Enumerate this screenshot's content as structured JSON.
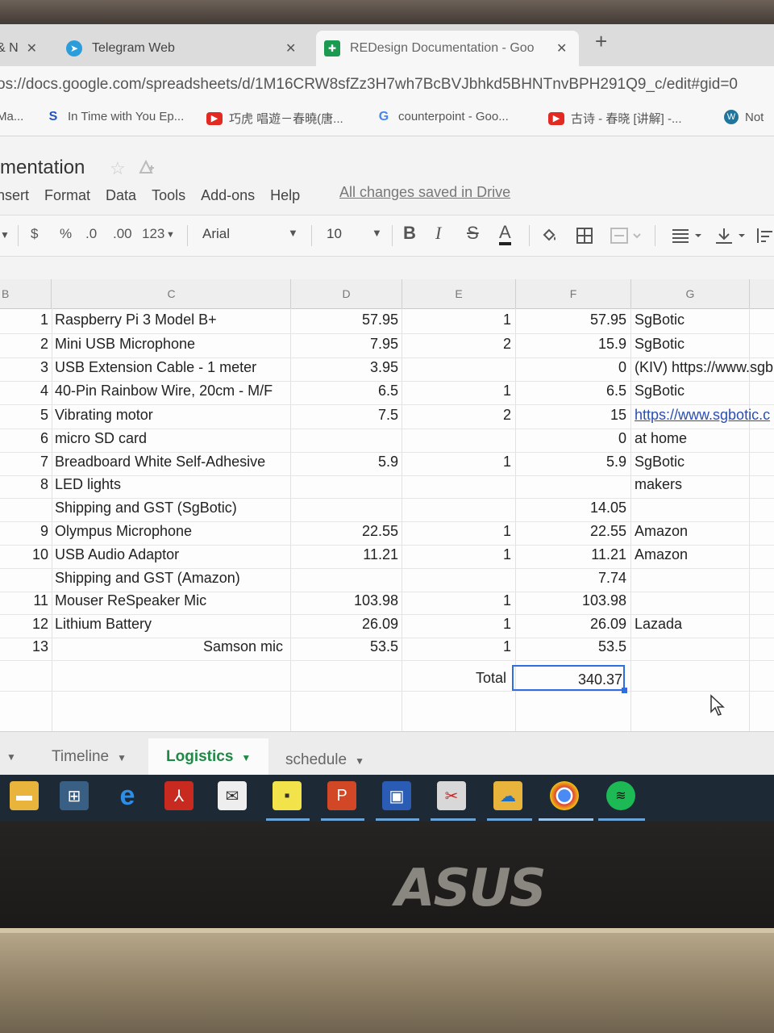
{
  "browser": {
    "tabs": [
      {
        "label": "& N",
        "close": "✕"
      },
      {
        "label": "Telegram Web",
        "close": "✕"
      },
      {
        "label": "REDesign Documentation - Goo",
        "close": "✕"
      }
    ],
    "new_tab": "+",
    "url": "os://docs.google.com/spreadsheets/d/1M16CRW8sfZz3H7wh7BcBVJbhkd5BHNTnvBPH291Q9_c/edit#gid=0",
    "bookmarks": [
      {
        "label": "Ma..."
      },
      {
        "label": "In Time with You Ep..."
      },
      {
        "label": "巧虎 唱遊－春曉(唐..."
      },
      {
        "label": "counterpoint - Goo..."
      },
      {
        "label": "古诗 - 春晓 [讲解] -..."
      },
      {
        "label": "Not"
      }
    ]
  },
  "doc": {
    "title": "mentation",
    "menu": [
      "nsert",
      "Format",
      "Data",
      "Tools",
      "Add-ons",
      "Help"
    ],
    "save_status": "All changes saved in Drive"
  },
  "toolbar": {
    "currency": "$",
    "percent": "%",
    "dec_less": ".0",
    "dec_more": ".00",
    "number_format": "123",
    "font": "Arial",
    "font_size": "10",
    "bold": "B",
    "italic": "I",
    "strike": "S",
    "text_color": "A"
  },
  "grid": {
    "columns": [
      "B",
      "C",
      "D",
      "E",
      "F",
      "G"
    ],
    "rows": [
      {
        "n": "1",
        "item": "Raspberry Pi 3 Model B+",
        "price": "57.95",
        "qty": "1",
        "total": "57.95",
        "source": "SgBotic"
      },
      {
        "n": "2",
        "item": "Mini USB Microphone",
        "price": "7.95",
        "qty": "2",
        "total": "15.9",
        "source": "SgBotic"
      },
      {
        "n": "3",
        "item": "USB Extension Cable - 1 meter",
        "price": "3.95",
        "qty": "",
        "total": "0",
        "source": "(KIV) https://www.sgb"
      },
      {
        "n": "4",
        "item": "40-Pin Rainbow Wire, 20cm - M/F",
        "price": "6.5",
        "qty": "1",
        "total": "6.5",
        "source": "SgBotic"
      },
      {
        "n": "5",
        "item": "Vibrating motor",
        "price": "7.5",
        "qty": "2",
        "total": "15",
        "source": "https://www.sgbotic.c"
      },
      {
        "n": "6",
        "item": "micro SD card",
        "price": "",
        "qty": "",
        "total": "0",
        "source": "at home"
      },
      {
        "n": "7",
        "item": "Breadboard White Self-Adhesive",
        "price": "5.9",
        "qty": "1",
        "total": "5.9",
        "source": "SgBotic"
      },
      {
        "n": "8",
        "item": "LED lights",
        "price": "",
        "qty": "",
        "total": "",
        "source": "makers"
      },
      {
        "n": "",
        "item": "Shipping and GST (SgBotic)",
        "price": "",
        "qty": "",
        "total": "14.05",
        "source": ""
      },
      {
        "n": "9",
        "item": "Olympus Microphone",
        "price": "22.55",
        "qty": "1",
        "total": "22.55",
        "source": "Amazon"
      },
      {
        "n": "10",
        "item": "USB Audio Adaptor",
        "price": "11.21",
        "qty": "1",
        "total": "11.21",
        "source": "Amazon"
      },
      {
        "n": "",
        "item": "Shipping and GST (Amazon)",
        "price": "",
        "qty": "",
        "total": "7.74",
        "source": ""
      },
      {
        "n": "11",
        "item": "Mouser ReSpeaker Mic",
        "price": "103.98",
        "qty": "1",
        "total": "103.98",
        "source": ""
      },
      {
        "n": "12",
        "item": "Lithium Battery",
        "price": "26.09",
        "qty": "1",
        "total": "26.09",
        "source": "Lazada"
      },
      {
        "n": "13",
        "item": "Samson mic",
        "price": "53.5",
        "qty": "1",
        "total": "53.5",
        "source": ""
      }
    ],
    "total_label": "Total",
    "total_value": "340.37"
  },
  "sheets": [
    {
      "label": "Timeline"
    },
    {
      "label": "Logistics"
    },
    {
      "label": "schedule"
    }
  ],
  "laptop_brand": "ASUS",
  "colors": {
    "accent": "#2f6de0",
    "sheets_green": "#1d8a45",
    "link": "#2a4fb0"
  }
}
